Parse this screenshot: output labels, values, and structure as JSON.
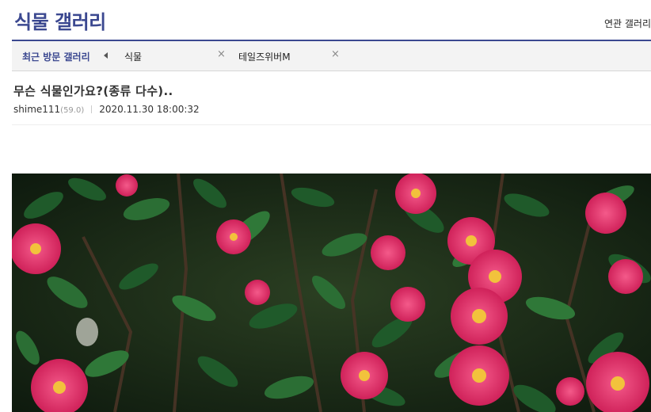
{
  "header": {
    "gallery_title": "식물 갤러리",
    "related_link": "연관 갤러리"
  },
  "recent_bar": {
    "label": "최근 방문 갤러리",
    "items": [
      {
        "label": "식물",
        "close": "×"
      },
      {
        "label": "테일즈위버M",
        "close": "×"
      }
    ]
  },
  "post": {
    "title": "무슨 식물인가요?(종류 다수)..",
    "author": "shime111",
    "author_score": "(59.0)",
    "date": "2020.11.30 18:00:32"
  },
  "colors": {
    "brand": "#3b4890",
    "flower": "#e0245e",
    "leaf": "#1f5a2a"
  }
}
